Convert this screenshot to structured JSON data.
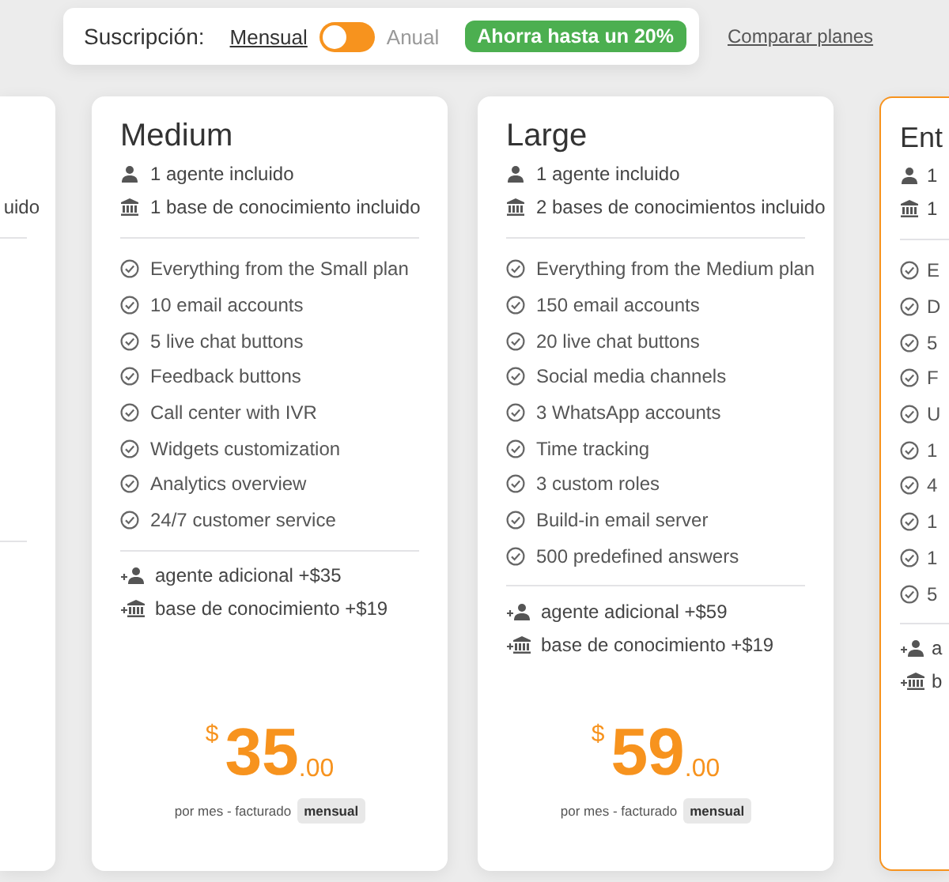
{
  "subscription": {
    "label": "Suscripción:",
    "options": [
      {
        "label": "Mensual",
        "selected": true
      },
      {
        "label": "Anual",
        "selected": false
      }
    ],
    "badge": "Ahorra hasta un 20%",
    "compare_link": "Comparar planes"
  },
  "left_fragment": {
    "included_line": "uido"
  },
  "plans": [
    {
      "title": "Medium",
      "included": [
        "1 agente incluido",
        "1 base de conocimiento incluido"
      ],
      "features": [
        "Everything from the Small plan",
        "10 email accounts",
        "5 live chat buttons",
        "Feedback buttons",
        "Call center with IVR",
        "Widgets customization",
        "Analytics overview",
        "24/7 customer service"
      ],
      "addons": [
        "agente adicional +$35",
        "base de conocimiento +$19"
      ],
      "price": {
        "currency": "$",
        "amount": "35",
        "cents": ".00",
        "note": "por mes - facturado",
        "period": "mensual"
      }
    },
    {
      "title": "Large",
      "included": [
        "1 agente incluido",
        "2 bases de conocimientos incluido"
      ],
      "features": [
        "Everything from the Medium plan",
        "150 email accounts",
        "20 live chat buttons",
        "Social media channels",
        "3 WhatsApp accounts",
        "Time tracking",
        "3 custom roles",
        "Build-in email server",
        "500 predefined answers"
      ],
      "addons": [
        "agente adicional +$59",
        "base de conocimiento +$19"
      ],
      "price": {
        "currency": "$",
        "amount": "59",
        "cents": ".00",
        "note": "por mes - facturado",
        "period": "mensual"
      }
    }
  ],
  "right_fragment": {
    "highlighted": true,
    "title": "Ent",
    "included": [
      "1",
      "1"
    ],
    "features": [
      "E",
      "D",
      "5",
      "F",
      "U",
      "1",
      "4",
      "1",
      "1",
      "5"
    ],
    "addons": [
      "a",
      "b"
    ]
  }
}
